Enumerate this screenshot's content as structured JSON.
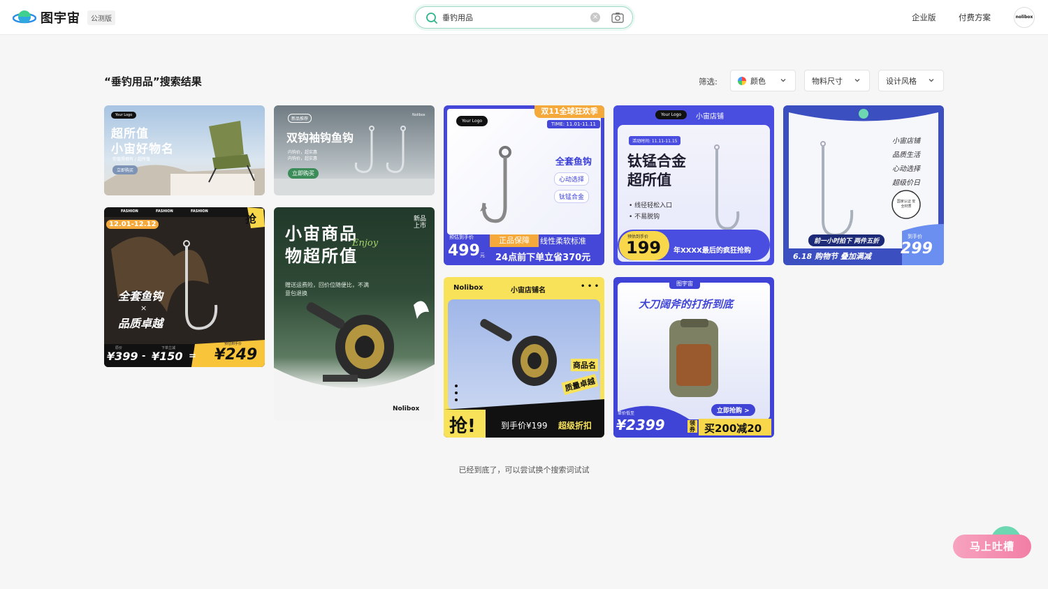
{
  "header": {
    "logo_text": "图宇宙",
    "beta_badge": "公测版",
    "search_value": "垂钓用品",
    "nav": {
      "enterprise": "企业版",
      "pricing": "付费方案"
    },
    "avatar_text": "nolibox"
  },
  "results": {
    "title": "“垂钓用品”搜索结果",
    "filter_label": "筛选:",
    "filters": {
      "color": "颜色",
      "size": "物料尺寸",
      "style": "设计风格"
    }
  },
  "cards": {
    "c1": {
      "logo": "Your Logo",
      "line1": "超所值",
      "line2": "小宙好物名",
      "sub": "你值得拥有 / 超所值",
      "btn": "立即购买"
    },
    "c2": {
      "tag": "新品推荐",
      "brand": "Nolibox",
      "title": "双钩袖钩鱼钩",
      "d1": "内钩价，超实惠",
      "d2": "内钩价，超实惠",
      "btn": "立即购买"
    },
    "c3": {
      "top_tag": "双11全球狂欢季",
      "time": "TIME: 11.01-11.11",
      "logo": "Your Logo",
      "title": "全套鱼钩",
      "pill1": "心动选择",
      "pill2": "钛锰合金",
      "est": "预估到手价",
      "price": "499",
      "unit": "元",
      "strip1": "正品保障",
      "strip2": "线性柔软标准",
      "bottom": "24点前下单立省370元"
    },
    "c4": {
      "logo": "Your Logo",
      "shop": "小宙店铺",
      "date": "活动时间: 11.11-11.15",
      "t1": "钛锰合金",
      "t2": "超所值",
      "b1": "线径轻松入口",
      "b2": "不易脱钩",
      "est": "预估到手价",
      "price": "199",
      "bottom": "年XXXX最后的疯狂抢购"
    },
    "c5": {
      "l1": "小宙店铺",
      "l2": "品质生活",
      "l3": "心动选择",
      "l4": "超级价日",
      "badge": "国家认证 安全材质",
      "strip": "前一小时拍下 两件五折",
      "promo": "6.18 购物节  叠加满减",
      "price_label": "到手价",
      "price": "299"
    },
    "c6": {
      "fashion": "FASHION",
      "date": "12.01-12.12",
      "grab": "抢",
      "t1": "全套鱼钩",
      "x": "×",
      "t2": "品质卓越",
      "lbl_orig": "原价",
      "lbl_off": "下单立减",
      "lbl_est": "预估到手价",
      "orig": "¥399",
      "minus": "-",
      "off": "¥150",
      "eq": "=",
      "final": "¥249"
    },
    "c7": {
      "t1": "小宙商品",
      "t2": "物超所值",
      "enjoy": "Enjoy",
      "side": "新品上市",
      "desc": "赠送运费险，回价位随便比，不满意包退换",
      "brand": "Nolibox"
    },
    "c8": {
      "brand": "Nolibox",
      "shop": "小宙店铺名",
      "dots": "• • •",
      "name": "商品名",
      "tag": "质量卓越",
      "grab": "抢!",
      "price": "到手价¥199",
      "deal": "超级折扣"
    },
    "c9": {
      "brand": "图宇宙",
      "title": "大刀阔斧的打折到底",
      "btn": "立即抢购 >",
      "lbl": "单价低至",
      "price": "¥2399",
      "coupon": "领券",
      "deal": "买200减20"
    }
  },
  "footer_note": "已经到底了，可以尝试换个搜索词试试",
  "feedback_label": "马上吐槽",
  "colors": {
    "accent": "#2fb58a",
    "blue": "#3a3fd6",
    "yellow": "#f8d84a",
    "pink": "#f27ea5"
  }
}
